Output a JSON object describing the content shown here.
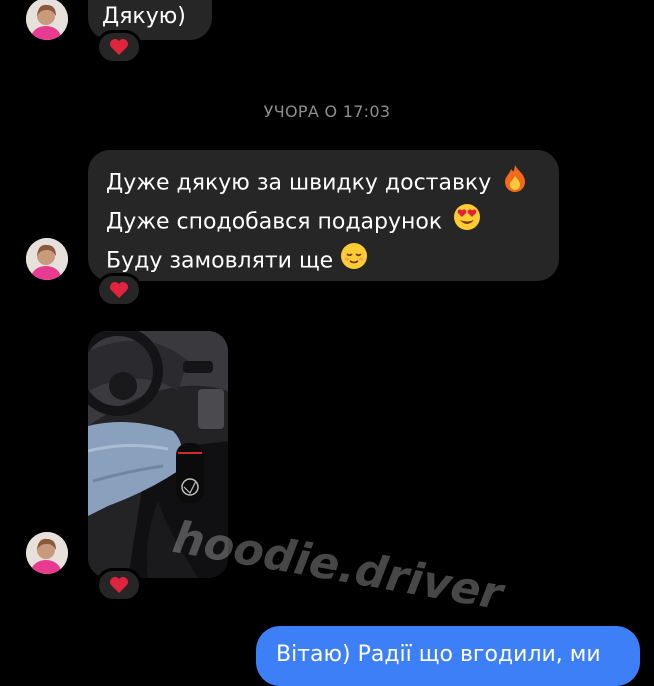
{
  "messages": {
    "top_fragment": "Дякую)",
    "timestamp": "УЧОРА О 17:03",
    "main_lines": [
      "Дуже дякую за швидку доставку",
      "Дуже сподобався подарунок",
      "Буду замовляти ще"
    ],
    "outgoing_fragment": "Вітаю) Радії що вгодили, ми"
  },
  "watermark": "hoodie.driver",
  "colors": {
    "background": "#000000",
    "incoming_bubble": "#262626",
    "outgoing_bubble": "#3d7ff7",
    "heart": "#e0243d",
    "timestamp": "#8e8e8e"
  },
  "icons": {
    "reaction": "red-heart-icon",
    "emoji_line1": "fire-icon",
    "emoji_line2": "heart-eyes-icon",
    "emoji_line3": "relieved-face-icon"
  }
}
